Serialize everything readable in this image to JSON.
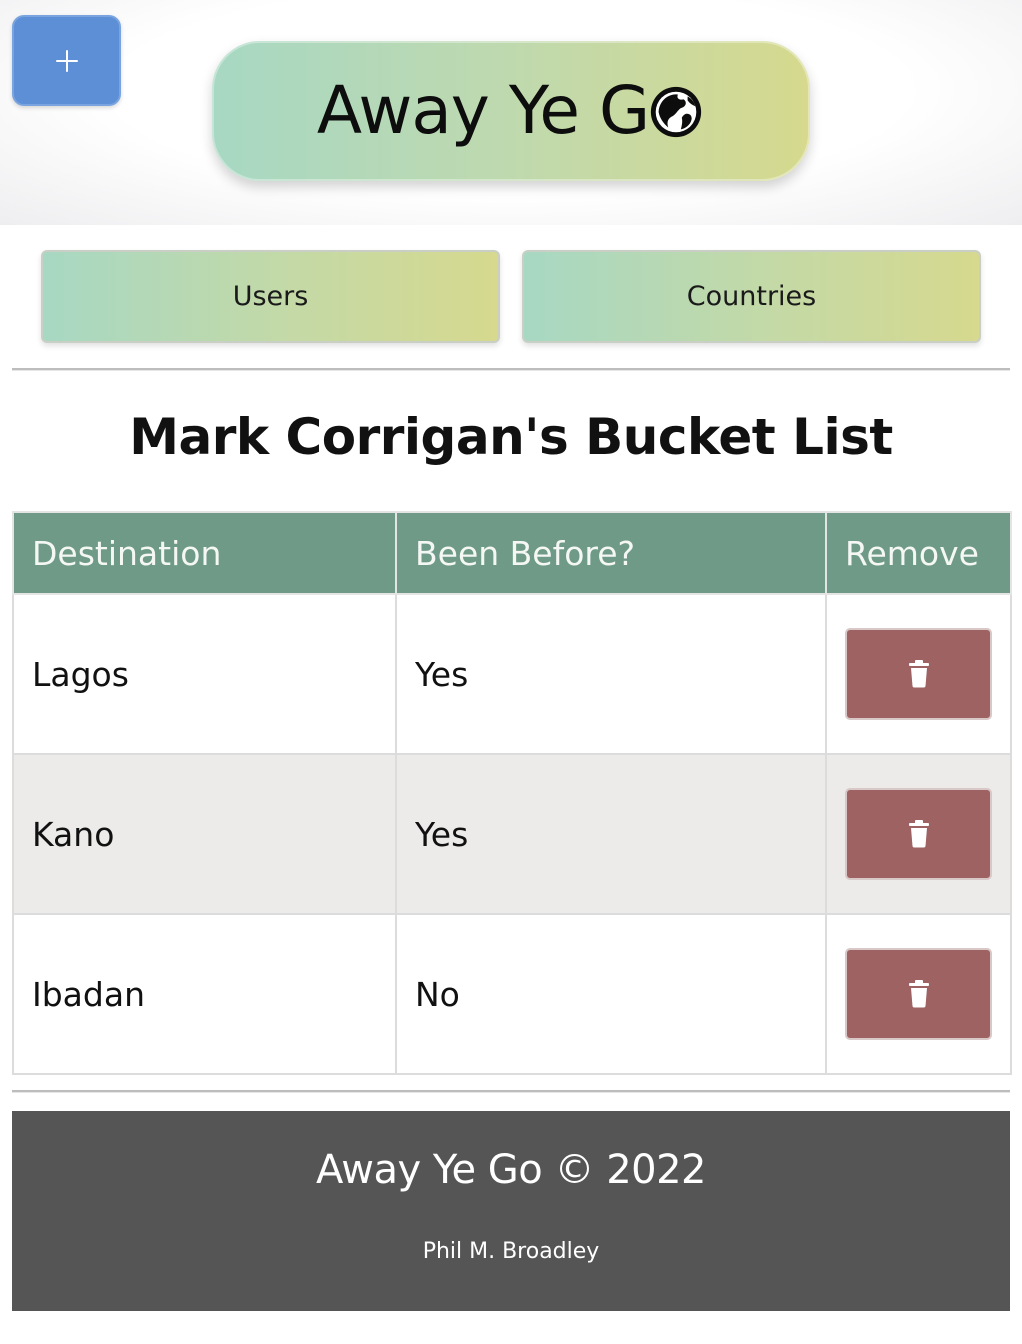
{
  "header": {
    "add_button_label": "+",
    "logo_text": "Away Ye G",
    "logo_icon": "globe-icon"
  },
  "nav": {
    "users_label": "Users",
    "countries_label": "Countries"
  },
  "page_title": "Mark Corrigan's Bucket List",
  "table": {
    "columns": [
      "Destination",
      "Been Before?",
      "Remove"
    ],
    "rows": [
      {
        "destination": "Lagos",
        "been_before": "Yes",
        "remove_icon": "trash-icon"
      },
      {
        "destination": "Kano",
        "been_before": "Yes",
        "remove_icon": "trash-icon"
      },
      {
        "destination": "Ibadan",
        "been_before": "No",
        "remove_icon": "trash-icon"
      }
    ]
  },
  "footer": {
    "title": "Away Ye Go © 2022",
    "author": "Phil M. Broadley"
  },
  "colors": {
    "add_button": "#5c8fd6",
    "table_header": "#6e9a87",
    "delete_button": "#9e6262",
    "footer_bg": "#565555",
    "gradient_start": "#a7d8c3",
    "gradient_end": "#d6d98e"
  }
}
